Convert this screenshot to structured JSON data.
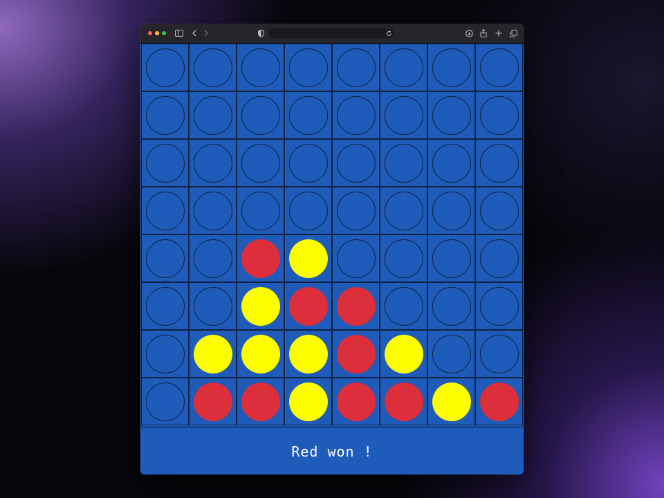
{
  "browser": {
    "traffic_lights": [
      "close",
      "minimize",
      "zoom"
    ],
    "toolbar_icons": [
      "sidebar-icon",
      "back-icon",
      "forward-icon",
      "shield-icon",
      "reload-icon",
      "download-icon",
      "share-icon",
      "new-tab-icon",
      "tabs-icon"
    ]
  },
  "game": {
    "rows": 8,
    "cols": 8,
    "colors": {
      "board": "#1f5bb8",
      "red": "#dd2e3b",
      "yellow": "#ffff00",
      "grid": "#0d2240"
    },
    "grid": [
      [
        "E",
        "E",
        "E",
        "E",
        "E",
        "E",
        "E",
        "E"
      ],
      [
        "E",
        "E",
        "E",
        "E",
        "E",
        "E",
        "E",
        "E"
      ],
      [
        "E",
        "E",
        "E",
        "E",
        "E",
        "E",
        "E",
        "E"
      ],
      [
        "E",
        "E",
        "E",
        "E",
        "E",
        "E",
        "E",
        "E"
      ],
      [
        "E",
        "E",
        "R",
        "Y",
        "E",
        "E",
        "E",
        "E"
      ],
      [
        "E",
        "E",
        "Y",
        "R",
        "R",
        "E",
        "E",
        "E"
      ],
      [
        "E",
        "Y",
        "Y",
        "Y",
        "R",
        "Y",
        "E",
        "E"
      ],
      [
        "E",
        "R",
        "R",
        "Y",
        "R",
        "R",
        "Y",
        "R"
      ]
    ],
    "status_text": "Red won !"
  }
}
